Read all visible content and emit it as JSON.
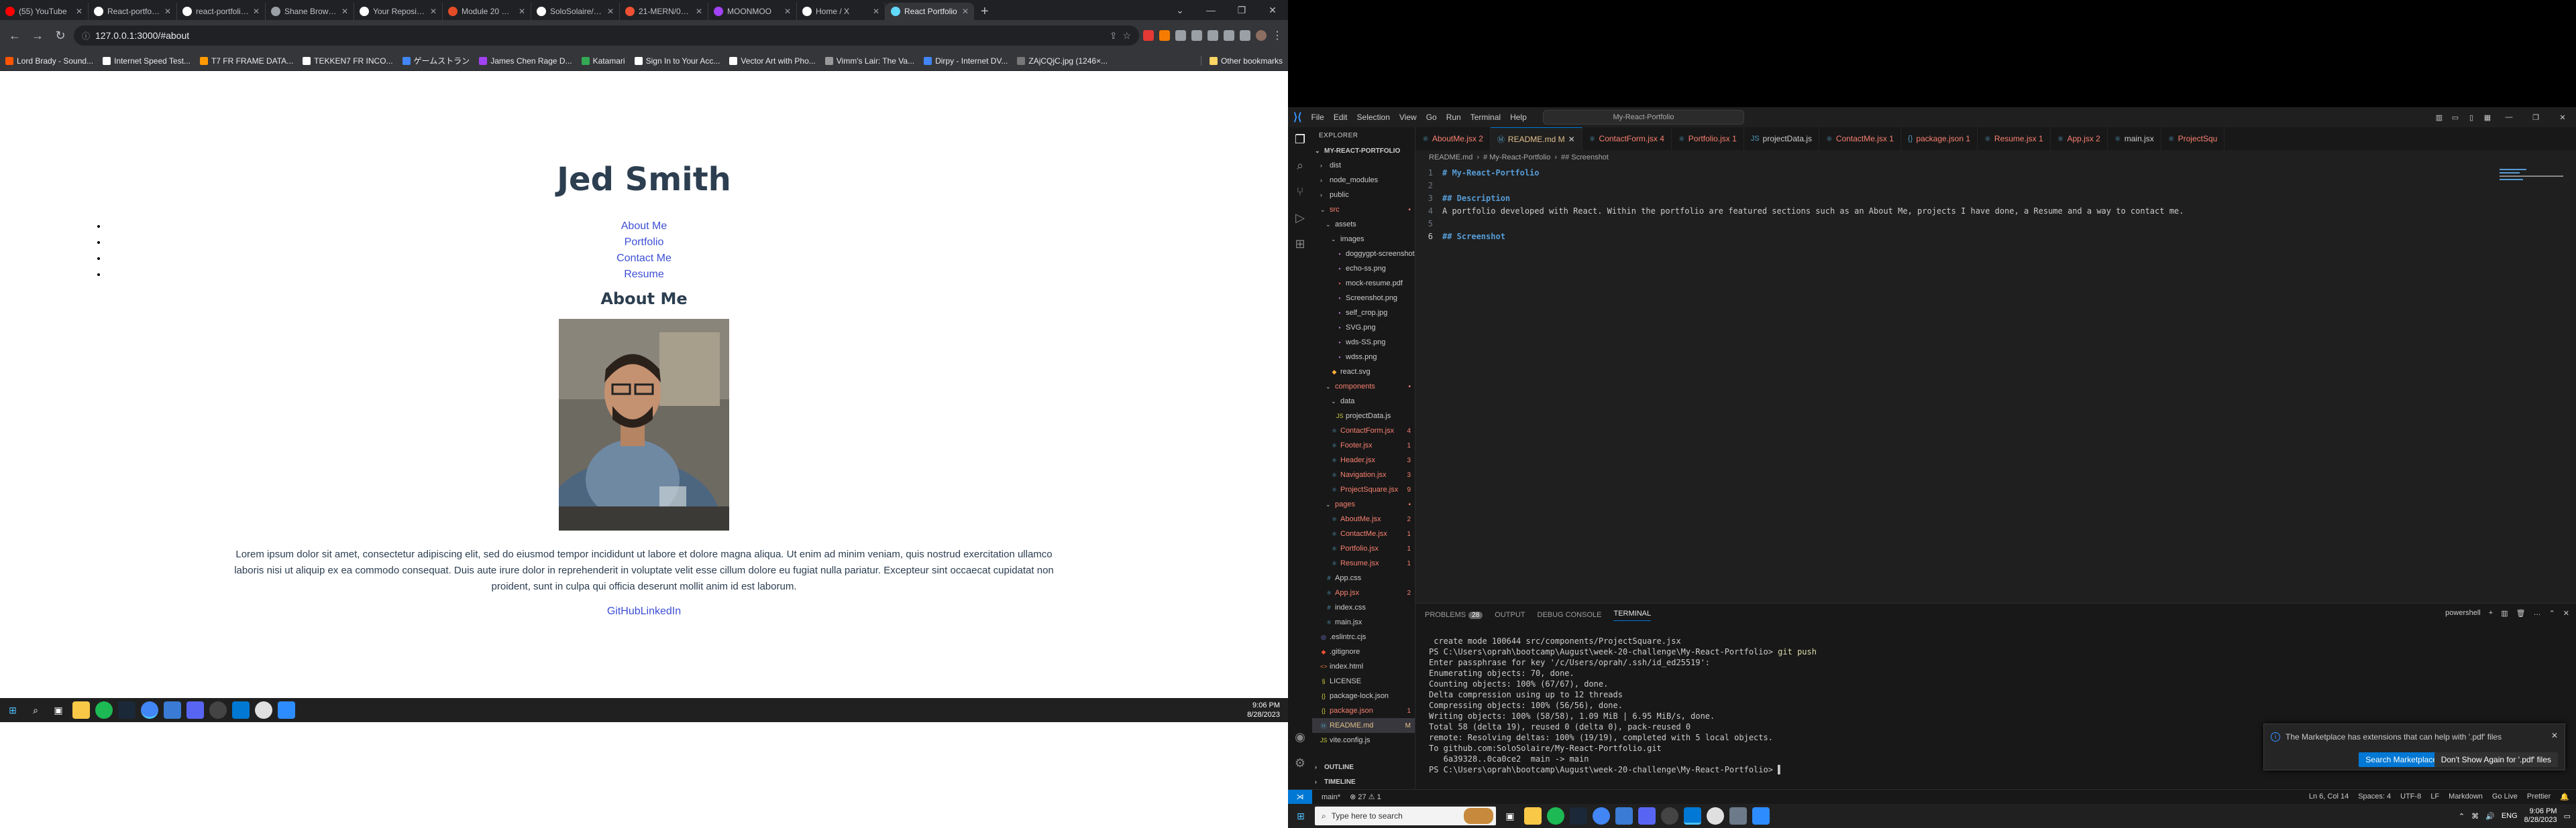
{
  "browser": {
    "tabs": [
      {
        "title": "(55) YouTube",
        "color": "#ff0000"
      },
      {
        "title": "React-portfolio/...",
        "color": "#ffffff"
      },
      {
        "title": "react-portfolio/...",
        "color": "#ffffff"
      },
      {
        "title": "Shane Browning",
        "color": "#9aa0a6"
      },
      {
        "title": "Your Repositor...",
        "color": "#ffffff"
      },
      {
        "title": "Module 20 Chal...",
        "color": "#e34c26"
      },
      {
        "title": "SoloSolaire/My...",
        "color": "#ffffff"
      },
      {
        "title": "21-MERN/01-A...",
        "color": "#f05033"
      },
      {
        "title": "MOONMOO",
        "color": "#a142f4"
      },
      {
        "title": "Home / X",
        "color": "#ffffff"
      },
      {
        "title": "React Portfolio",
        "color": "#61dafb"
      }
    ],
    "active_tab": 10,
    "url": "127.0.0.1:3000/#about",
    "bookmarks": [
      {
        "label": "Lord Brady - Sound...",
        "color": "#ff5500"
      },
      {
        "label": "Internet Speed Test...",
        "color": "#ffffff"
      },
      {
        "label": "T7 FR FRAME DATA...",
        "color": "#ff9900"
      },
      {
        "label": "TEKKEN7 FR INCO...",
        "color": "#ffffff"
      },
      {
        "label": "ゲームストラン",
        "color": "#4285f4"
      },
      {
        "label": "James Chen Rage D...",
        "color": "#a142f4"
      },
      {
        "label": "Katamari",
        "color": "#34a853"
      },
      {
        "label": "Sign In to Your Acc...",
        "color": "#ffffff"
      },
      {
        "label": "Vector Art with Pho...",
        "color": "#ffffff"
      },
      {
        "label": "Vimm's Lair: The Va...",
        "color": "#999999"
      },
      {
        "label": "Dirpy - Internet DV...",
        "color": "#4285f4"
      },
      {
        "label": "ZAjCQjC.jpg (1246×...",
        "color": "#777777"
      }
    ],
    "other_bookmarks": "Other bookmarks"
  },
  "page": {
    "title": "Jed Smith",
    "nav": [
      "About Me",
      "Portfolio",
      "Contact Me",
      "Resume"
    ],
    "section_title": "About Me",
    "bio": "Lorem ipsum dolor sit amet, consectetur adipiscing elit, sed do eiusmod tempor incididunt ut labore et dolore magna aliqua. Ut enim ad minim veniam, quis nostrud exercitation ullamco laboris nisi ut aliquip ex ea commodo consequat. Duis aute irure dolor in reprehenderit in voluptate velit esse cillum dolore eu fugiat nulla pariatur. Excepteur sint occaecat cupidatat non proident, sunt in culpa qui officia deserunt mollit anim id est laborum.",
    "links": "GitHubLinkedIn"
  },
  "taskbar_left": {
    "time": "9:06 PM",
    "date": "8/28/2023"
  },
  "vscode": {
    "menu": [
      "File",
      "Edit",
      "Selection",
      "View",
      "Go",
      "Run",
      "Terminal",
      "Help"
    ],
    "search": "My-React-Portfolio",
    "explorer_title": "EXPLORER",
    "project": "MY-REACT-PORTFOLIO",
    "tree": [
      {
        "name": "dist",
        "indent": 1,
        "type": "folder-closed",
        "state": ""
      },
      {
        "name": "node_modules",
        "indent": 1,
        "type": "folder-closed",
        "state": ""
      },
      {
        "name": "public",
        "indent": 1,
        "type": "folder-closed",
        "state": ""
      },
      {
        "name": "src",
        "indent": 1,
        "type": "folder-open",
        "state": "err",
        "badge": "•"
      },
      {
        "name": "assets",
        "indent": 2,
        "type": "folder-open",
        "state": ""
      },
      {
        "name": "images",
        "indent": 3,
        "type": "folder-open",
        "state": ""
      },
      {
        "name": "doggygpt-screenshot.png",
        "indent": 4,
        "type": "img",
        "state": ""
      },
      {
        "name": "echo-ss.png",
        "indent": 4,
        "type": "img",
        "state": ""
      },
      {
        "name": "mock-resume.pdf",
        "indent": 4,
        "type": "pdf",
        "state": ""
      },
      {
        "name": "Screenshot.png",
        "indent": 4,
        "type": "img",
        "state": ""
      },
      {
        "name": "self_crop.jpg",
        "indent": 4,
        "type": "img",
        "state": ""
      },
      {
        "name": "SVG.png",
        "indent": 4,
        "type": "img",
        "state": ""
      },
      {
        "name": "wds-SS.png",
        "indent": 4,
        "type": "img",
        "state": ""
      },
      {
        "name": "wdss.png",
        "indent": 4,
        "type": "img",
        "state": ""
      },
      {
        "name": "react.svg",
        "indent": 3,
        "type": "svg",
        "state": ""
      },
      {
        "name": "components",
        "indent": 2,
        "type": "folder-open",
        "state": "err",
        "badge": "•"
      },
      {
        "name": "data",
        "indent": 3,
        "type": "folder-open",
        "state": ""
      },
      {
        "name": "projectData.js",
        "indent": 4,
        "type": "js",
        "state": ""
      },
      {
        "name": "ContactForm.jsx",
        "indent": 3,
        "type": "jsx",
        "state": "err",
        "badge": "4"
      },
      {
        "name": "Footer.jsx",
        "indent": 3,
        "type": "jsx",
        "state": "err",
        "badge": "1"
      },
      {
        "name": "Header.jsx",
        "indent": 3,
        "type": "jsx",
        "state": "err",
        "badge": "3"
      },
      {
        "name": "Navigation.jsx",
        "indent": 3,
        "type": "jsx",
        "state": "err",
        "badge": "3"
      },
      {
        "name": "ProjectSquare.jsx",
        "indent": 3,
        "type": "jsx",
        "state": "err",
        "badge": "9"
      },
      {
        "name": "pages",
        "indent": 2,
        "type": "folder-open",
        "state": "err",
        "badge": "•"
      },
      {
        "name": "AboutMe.jsx",
        "indent": 3,
        "type": "jsx",
        "state": "err",
        "badge": "2"
      },
      {
        "name": "ContactMe.jsx",
        "indent": 3,
        "type": "jsx",
        "state": "err",
        "badge": "1"
      },
      {
        "name": "Portfolio.jsx",
        "indent": 3,
        "type": "jsx",
        "state": "err",
        "badge": "1"
      },
      {
        "name": "Resume.jsx",
        "indent": 3,
        "type": "jsx",
        "state": "err",
        "badge": "1"
      },
      {
        "name": "App.css",
        "indent": 2,
        "type": "css",
        "state": ""
      },
      {
        "name": "App.jsx",
        "indent": 2,
        "type": "jsx",
        "state": "err",
        "badge": "2"
      },
      {
        "name": "index.css",
        "indent": 2,
        "type": "css",
        "state": ""
      },
      {
        "name": "main.jsx",
        "indent": 2,
        "type": "jsx",
        "state": ""
      },
      {
        "name": ".eslintrc.cjs",
        "indent": 1,
        "type": "eslint",
        "state": ""
      },
      {
        "name": ".gitignore",
        "indent": 1,
        "type": "git",
        "state": ""
      },
      {
        "name": "index.html",
        "indent": 1,
        "type": "html",
        "state": ""
      },
      {
        "name": "LICENSE",
        "indent": 1,
        "type": "license",
        "state": ""
      },
      {
        "name": "package-lock.json",
        "indent": 1,
        "type": "json",
        "state": ""
      },
      {
        "name": "package.json",
        "indent": 1,
        "type": "json",
        "state": "err",
        "badge": "1"
      },
      {
        "name": "README.md",
        "indent": 1,
        "type": "md",
        "state": "sel",
        "badge": "M"
      },
      {
        "name": "vite.config.js",
        "indent": 1,
        "type": "js",
        "state": ""
      }
    ],
    "outline": "OUTLINE",
    "timeline": "TIMELINE",
    "tabs": [
      {
        "label": "AboutMe.jsx 2",
        "active": false
      },
      {
        "label": "README.md M",
        "active": true
      },
      {
        "label": "ContactForm.jsx 4",
        "active": false
      },
      {
        "label": "Portfolio.jsx 1",
        "active": false
      },
      {
        "label": "projectData.js",
        "active": false
      },
      {
        "label": "ContactMe.jsx 1",
        "active": false
      },
      {
        "label": "package.json 1",
        "active": false
      },
      {
        "label": "Resume.jsx 1",
        "active": false
      },
      {
        "label": "App.jsx 2",
        "active": false
      },
      {
        "label": "main.jsx",
        "active": false
      },
      {
        "label": "ProjectSqu",
        "active": false
      }
    ],
    "breadcrumb": [
      "README.md",
      "# My-React-Portfolio",
      "## Screenshot"
    ],
    "code": [
      {
        "n": "1",
        "t": "# My-React-Portfolio",
        "h": true
      },
      {
        "n": "2",
        "t": "",
        "h": false
      },
      {
        "n": "3",
        "t": "## Description",
        "h": true
      },
      {
        "n": "4",
        "t": "A portfolio developed with React. Within the portfolio are featured sections such as an About Me, projects I have done, a Resume and a way to contact me.",
        "h": false
      },
      {
        "n": "5",
        "t": "",
        "h": false
      },
      {
        "n": "6",
        "t": "## Screenshot",
        "h": true
      }
    ],
    "panel_tabs": {
      "problems": "PROBLEMS",
      "problems_count": "28",
      "output": "OUTPUT",
      "debug": "DEBUG CONSOLE",
      "terminal": "TERMINAL",
      "shell": "powershell"
    },
    "terminal": [
      " create mode 100644 src/components/ProjectSquare.jsx",
      "PS C:\\Users\\oprah\\bootcamp\\August\\week-20-challenge\\My-React-Portfolio> git push",
      "Enter passphrase for key '/c/Users/oprah/.ssh/id_ed25519':",
      "Enumerating objects: 70, done.",
      "Counting objects: 100% (67/67), done.",
      "Delta compression using up to 12 threads",
      "Compressing objects: 100% (56/56), done.",
      "Writing objects: 100% (58/58), 1.09 MiB | 6.95 MiB/s, done.",
      "Total 58 (delta 19), reused 0 (delta 0), pack-reused 0",
      "remote: Resolving deltas: 100% (19/19), completed with 5 local objects.",
      "To github.com:SoloSolaire/My-React-Portfolio.git",
      "   6a39328..0ca0ce2  main -> main",
      "PS C:\\Users\\oprah\\bootcamp\\August\\week-20-challenge\\My-React-Portfolio> "
    ],
    "toast": {
      "message": "The Marketplace has extensions that can help with '.pdf' files",
      "primary": "Search Marketplace",
      "secondary": "Don't Show Again for '.pdf' files"
    },
    "status": {
      "branch": "main*",
      "problems": "⊗ 27 ⚠ 1",
      "position": "Ln 6, Col 14",
      "spaces": "Spaces: 4",
      "encoding": "UTF-8",
      "eol": "LF",
      "lang": "Markdown",
      "live": "Go Live",
      "prettier": "Prettier"
    }
  },
  "taskbar_right": {
    "search": "Type here to search",
    "lang": "ENG",
    "time": "9:06 PM",
    "date": "8/28/2023"
  }
}
